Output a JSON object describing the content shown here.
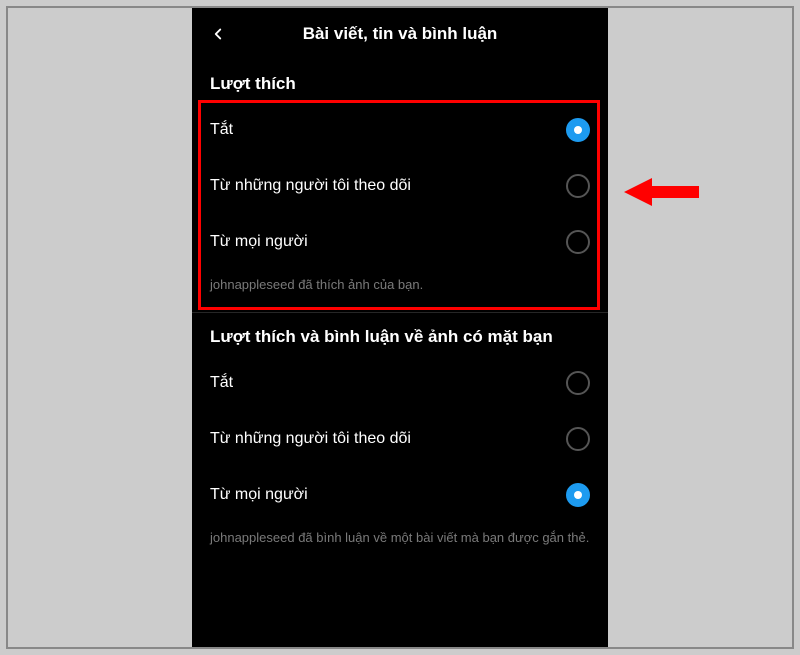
{
  "header": {
    "title": "Bài viết, tin và bình luận"
  },
  "sections": [
    {
      "title": "Lượt thích",
      "options": [
        {
          "label": "Tắt",
          "selected": true
        },
        {
          "label": "Từ những người tôi theo dõi",
          "selected": false
        },
        {
          "label": "Từ mọi người",
          "selected": false
        }
      ],
      "hint": "johnappleseed đã thích ảnh của bạn."
    },
    {
      "title": "Lượt thích và bình luận về ảnh có mặt bạn",
      "options": [
        {
          "label": "Tắt",
          "selected": false
        },
        {
          "label": "Từ những người tôi theo dõi",
          "selected": false
        },
        {
          "label": "Từ mọi người",
          "selected": true
        }
      ],
      "hint": "johnappleseed đã bình luận về một bài viết mà bạn được gắn thẻ."
    }
  ],
  "annotation": {
    "highlight_color": "#ff0000",
    "arrow_color": "#ff0000"
  }
}
